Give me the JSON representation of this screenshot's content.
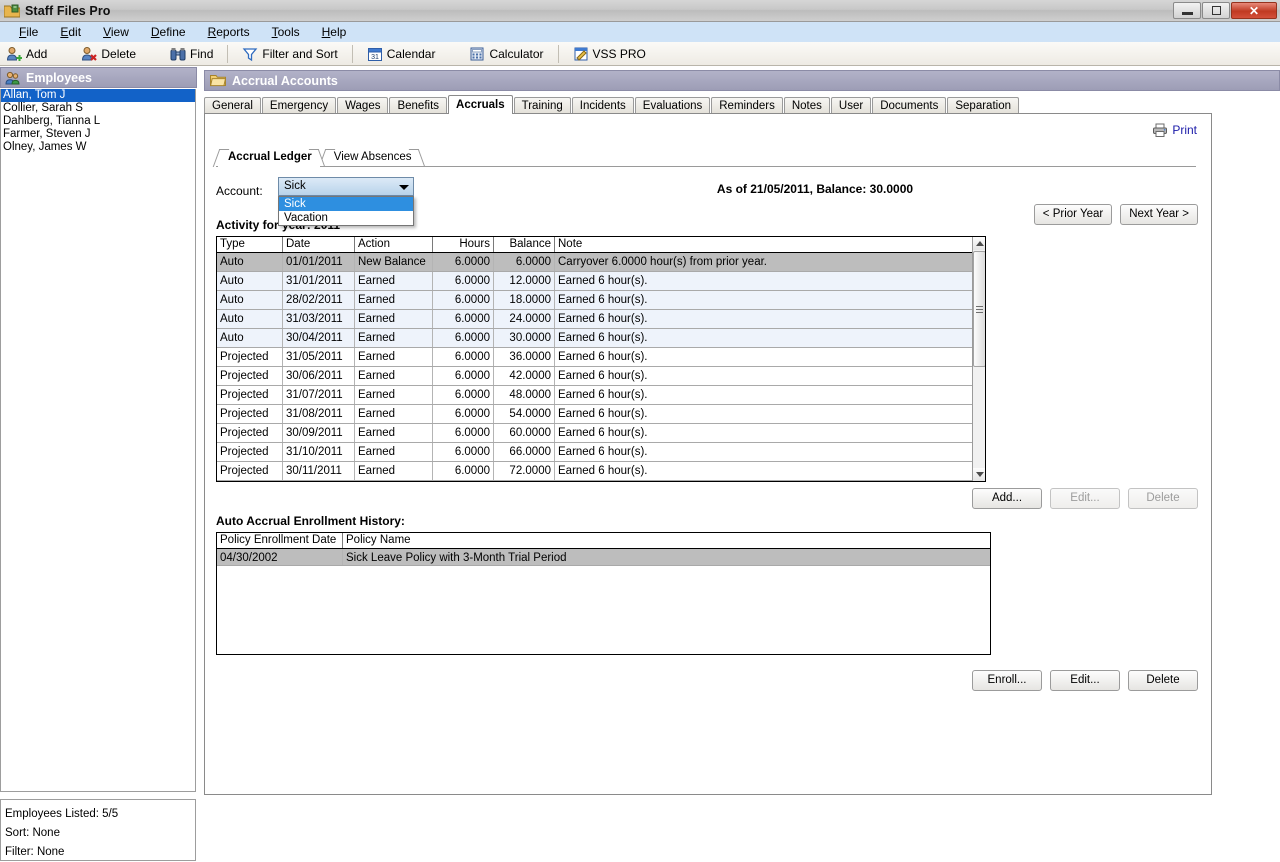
{
  "window": {
    "title": "Staff Files Pro",
    "icon": "application-icon",
    "minimize_label": "Minimize",
    "maximize_label": "Maximize",
    "close_label": "✕"
  },
  "menubar": {
    "items": [
      {
        "label": "File",
        "accel": "F"
      },
      {
        "label": "Edit",
        "accel": "E"
      },
      {
        "label": "View",
        "accel": "V"
      },
      {
        "label": "Define",
        "accel": "D"
      },
      {
        "label": "Reports",
        "accel": "R"
      },
      {
        "label": "Tools",
        "accel": "T"
      },
      {
        "label": "Help",
        "accel": "H"
      }
    ]
  },
  "toolbar": {
    "buttons": [
      {
        "label": "Add",
        "icon": "add-user-icon"
      },
      {
        "label": "Delete",
        "icon": "delete-user-icon"
      },
      {
        "label": "Find",
        "icon": "binoculars-icon"
      },
      {
        "label": "Filter and Sort",
        "icon": "funnel-icon"
      },
      {
        "label": "Calendar",
        "icon": "calendar-icon"
      },
      {
        "label": "Calculator",
        "icon": "calculator-icon"
      },
      {
        "label": "VSS PRO",
        "icon": "vss-pro-icon"
      }
    ]
  },
  "sidebar": {
    "header": {
      "title": "Employees",
      "icon": "employees-icon"
    },
    "employees": [
      {
        "name": "Allan, Tom J",
        "selected": true
      },
      {
        "name": "Collier, Sarah S",
        "selected": false
      },
      {
        "name": "Dahlberg, Tianna L",
        "selected": false
      },
      {
        "name": "Farmer, Steven J",
        "selected": false
      },
      {
        "name": "Olney, James W",
        "selected": false
      }
    ],
    "status": {
      "employees_listed": "Employees Listed: 5/5",
      "sort": "Sort: None",
      "filter": "Filter: None"
    }
  },
  "content": {
    "header": {
      "title": "Accrual Accounts",
      "icon": "folder-icon"
    },
    "tabs": [
      {
        "label": "General",
        "active": false
      },
      {
        "label": "Emergency",
        "active": false
      },
      {
        "label": "Wages",
        "active": false
      },
      {
        "label": "Benefits",
        "active": false
      },
      {
        "label": "Accruals",
        "active": true
      },
      {
        "label": "Training",
        "active": false
      },
      {
        "label": "Incidents",
        "active": false
      },
      {
        "label": "Evaluations",
        "active": false
      },
      {
        "label": "Reminders",
        "active": false
      },
      {
        "label": "Notes",
        "active": false
      },
      {
        "label": "User",
        "active": false
      },
      {
        "label": "Documents",
        "active": false
      },
      {
        "label": "Separation",
        "active": false
      }
    ],
    "print_link": {
      "label": "Print",
      "icon": "printer-icon"
    },
    "inner_tabs": [
      {
        "label": "Accrual Ledger",
        "active": true
      },
      {
        "label": "View Absences",
        "active": false
      }
    ],
    "account": {
      "label": "Account:",
      "selected_value": "Sick",
      "dropdown_open": true,
      "options": [
        {
          "label": "Sick",
          "highlighted": true
        },
        {
          "label": "Vacation",
          "highlighted": false
        }
      ]
    },
    "balance_text": "As of 21/05/2011, Balance: 30.0000",
    "year_buttons": [
      {
        "label": "< Prior Year",
        "disabled": false
      },
      {
        "label": "Next Year >",
        "disabled": false
      }
    ],
    "activity_label": "Activity for year: 2011",
    "ledger": {
      "columns": [
        "Type",
        "Date",
        "Action",
        "Hours",
        "Balance",
        "Note"
      ],
      "rows": [
        {
          "type": "Auto",
          "date": "01/01/2011",
          "action": "New Balance",
          "hours": "6.0000",
          "balance": "6.0000",
          "note": "Carryover 6.0000 hour(s) from prior year.",
          "state": "selected"
        },
        {
          "type": "Auto",
          "date": "31/01/2011",
          "action": "Earned",
          "hours": "6.0000",
          "balance": "12.0000",
          "note": "Earned 6 hour(s).",
          "state": "alt"
        },
        {
          "type": "Auto",
          "date": "28/02/2011",
          "action": "Earned",
          "hours": "6.0000",
          "balance": "18.0000",
          "note": "Earned 6 hour(s).",
          "state": "alt"
        },
        {
          "type": "Auto",
          "date": "31/03/2011",
          "action": "Earned",
          "hours": "6.0000",
          "balance": "24.0000",
          "note": "Earned 6 hour(s).",
          "state": "alt"
        },
        {
          "type": "Auto",
          "date": "30/04/2011",
          "action": "Earned",
          "hours": "6.0000",
          "balance": "30.0000",
          "note": "Earned 6 hour(s).",
          "state": "alt"
        },
        {
          "type": "Projected",
          "date": "31/05/2011",
          "action": "Earned",
          "hours": "6.0000",
          "balance": "36.0000",
          "note": "Earned 6 hour(s).",
          "state": "normal"
        },
        {
          "type": "Projected",
          "date": "30/06/2011",
          "action": "Earned",
          "hours": "6.0000",
          "balance": "42.0000",
          "note": "Earned 6 hour(s).",
          "state": "normal"
        },
        {
          "type": "Projected",
          "date": "31/07/2011",
          "action": "Earned",
          "hours": "6.0000",
          "balance": "48.0000",
          "note": "Earned 6 hour(s).",
          "state": "normal"
        },
        {
          "type": "Projected",
          "date": "31/08/2011",
          "action": "Earned",
          "hours": "6.0000",
          "balance": "54.0000",
          "note": "Earned 6 hour(s).",
          "state": "normal"
        },
        {
          "type": "Projected",
          "date": "30/09/2011",
          "action": "Earned",
          "hours": "6.0000",
          "balance": "60.0000",
          "note": "Earned 6 hour(s).",
          "state": "normal"
        },
        {
          "type": "Projected",
          "date": "31/10/2011",
          "action": "Earned",
          "hours": "6.0000",
          "balance": "66.0000",
          "note": "Earned 6 hour(s).",
          "state": "normal"
        },
        {
          "type": "Projected",
          "date": "30/11/2011",
          "action": "Earned",
          "hours": "6.0000",
          "balance": "72.0000",
          "note": "Earned 6 hour(s).",
          "state": "normal"
        }
      ]
    },
    "ledger_buttons": [
      {
        "label": "Add...",
        "disabled": false
      },
      {
        "label": "Edit...",
        "disabled": true
      },
      {
        "label": "Delete",
        "disabled": true
      }
    ],
    "enrollment": {
      "label": "Auto Accrual Enrollment History:",
      "columns": [
        "Policy Enrollment Date",
        "Policy Name"
      ],
      "rows": [
        {
          "date": "04/30/2002",
          "name": "Sick Leave Policy with 3-Month Trial Period"
        }
      ]
    },
    "enrollment_buttons": [
      {
        "label": "Enroll...",
        "disabled": false
      },
      {
        "label": "Edit...",
        "disabled": false
      },
      {
        "label": "Delete",
        "disabled": false
      }
    ]
  }
}
